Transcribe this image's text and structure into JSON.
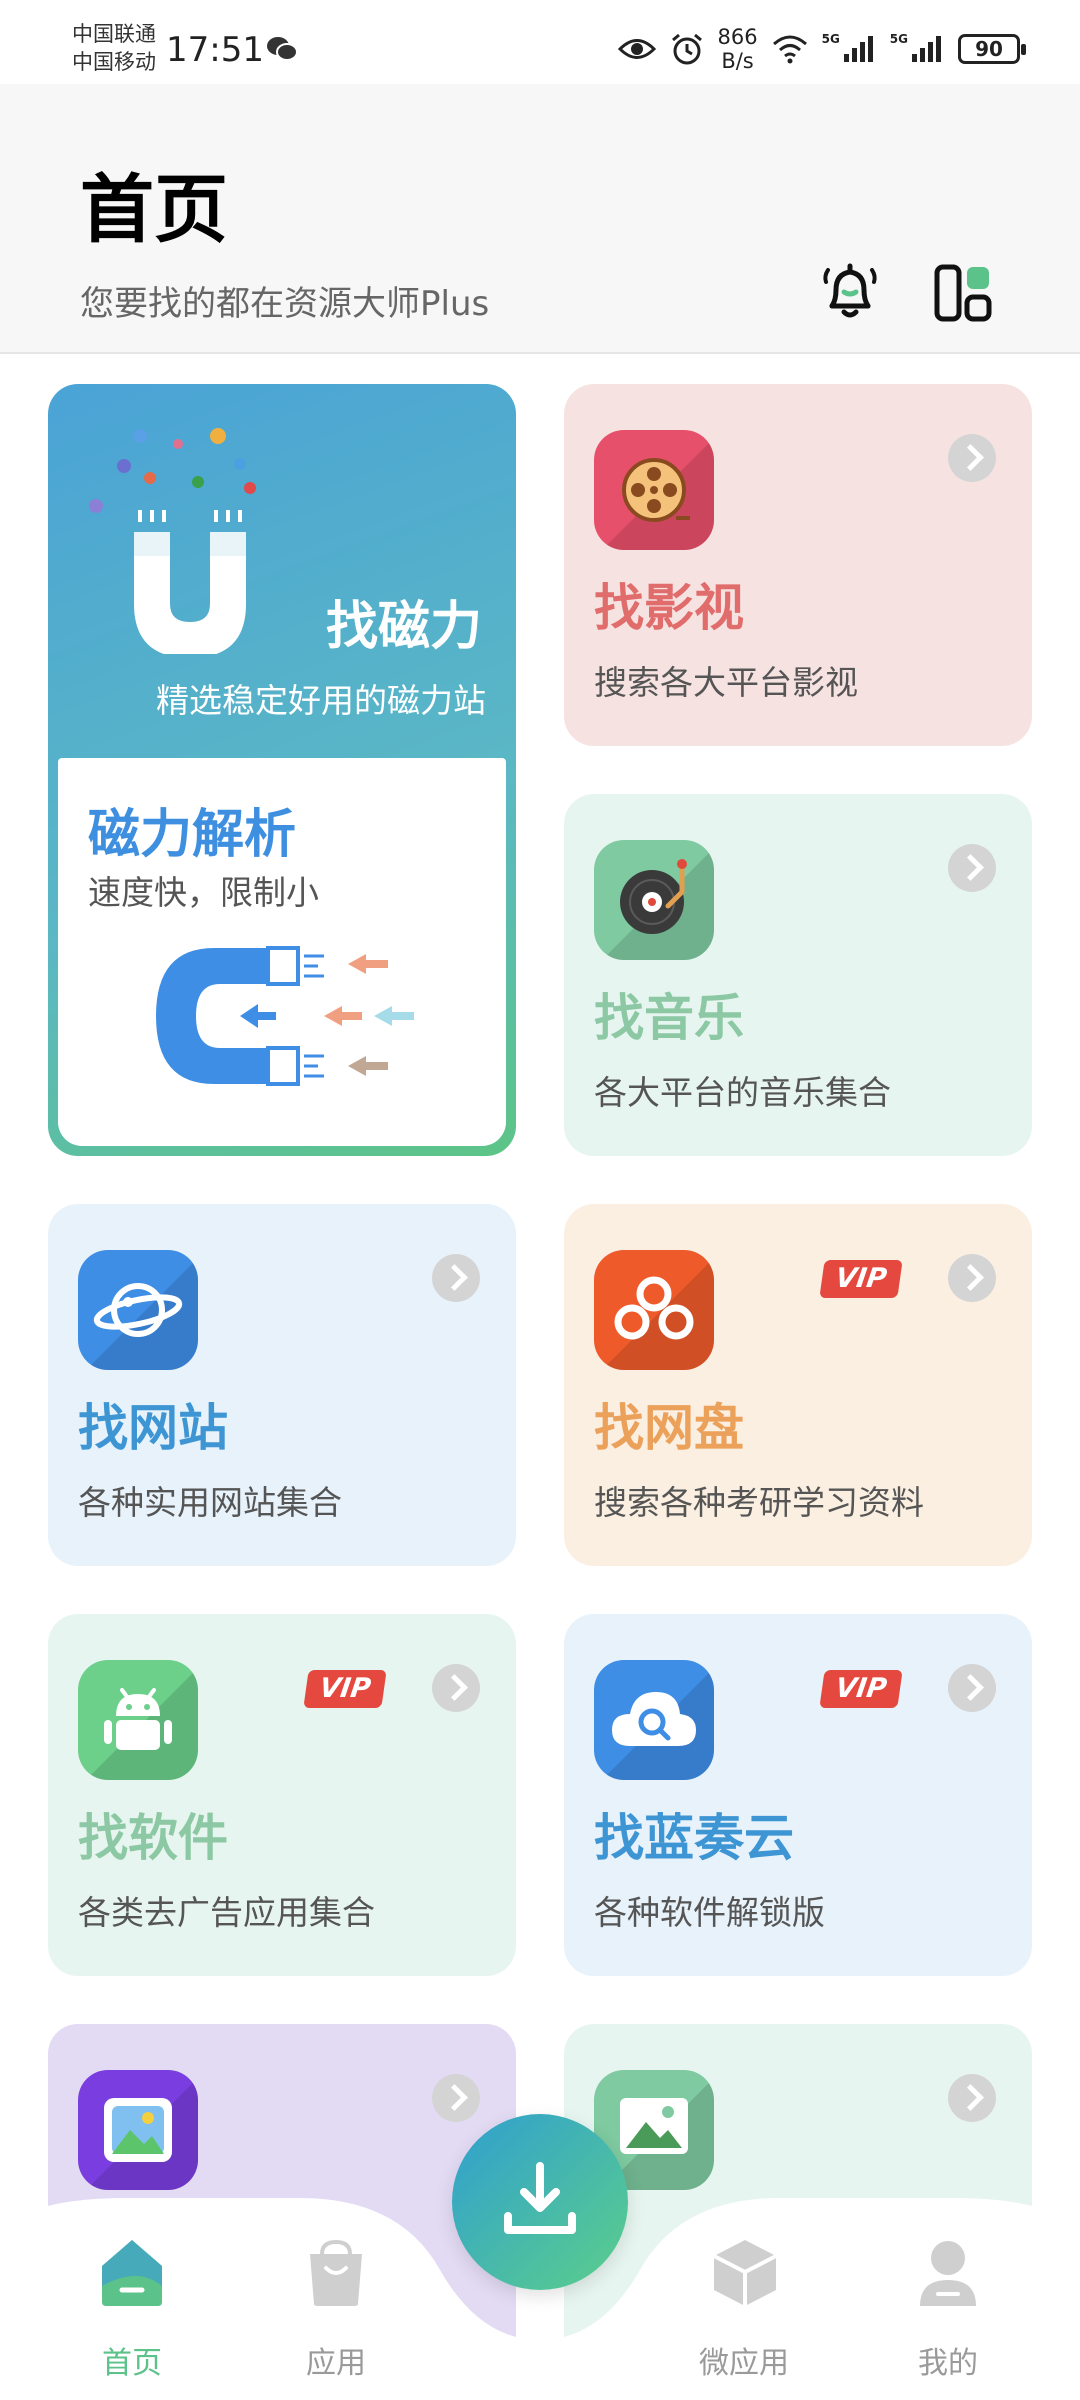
{
  "status_bar": {
    "carrier_1": "中国联通",
    "carrier_2": "中国移动",
    "time": "17:51",
    "speed_value": "866",
    "speed_unit": "B/s",
    "signal_1": "5G",
    "signal_2": "5G",
    "battery": "90"
  },
  "header": {
    "title": "首页",
    "subtitle": "您要找的都在资源大师Plus"
  },
  "cards": {
    "magnet": {
      "title": "找磁力",
      "desc": "精选稳定好用的磁力站"
    },
    "magnet_parse": {
      "title": "磁力解析",
      "desc": "速度快，限制小"
    },
    "video": {
      "title": "找影视",
      "desc": "搜索各大平台影视"
    },
    "music": {
      "title": "找音乐",
      "desc": "各大平台的音乐集合"
    },
    "website": {
      "title": "找网站",
      "desc": "各种实用网站集合"
    },
    "netdisk": {
      "title": "找网盘",
      "desc": "搜索各种考研学习资料",
      "badge": "VIP"
    },
    "software": {
      "title": "找软件",
      "desc": "各类去广告应用集合",
      "badge": "VIP"
    },
    "lanzou": {
      "title": "找蓝奏云",
      "desc": "各种软件解锁版",
      "badge": "VIP"
    }
  },
  "bottom_nav": {
    "items": [
      {
        "label": "首页"
      },
      {
        "label": "应用"
      },
      {
        "label": "微应用"
      },
      {
        "label": "我的"
      }
    ]
  },
  "colors": {
    "video_title": "#e06c6c",
    "music_title": "#8cc8a4",
    "website_title": "#3e95d4",
    "netdisk_title": "#eba15a",
    "software_title": "#8cc8a4",
    "lanzou_title": "#3e95d4",
    "nav_active": "#5bc28a"
  }
}
